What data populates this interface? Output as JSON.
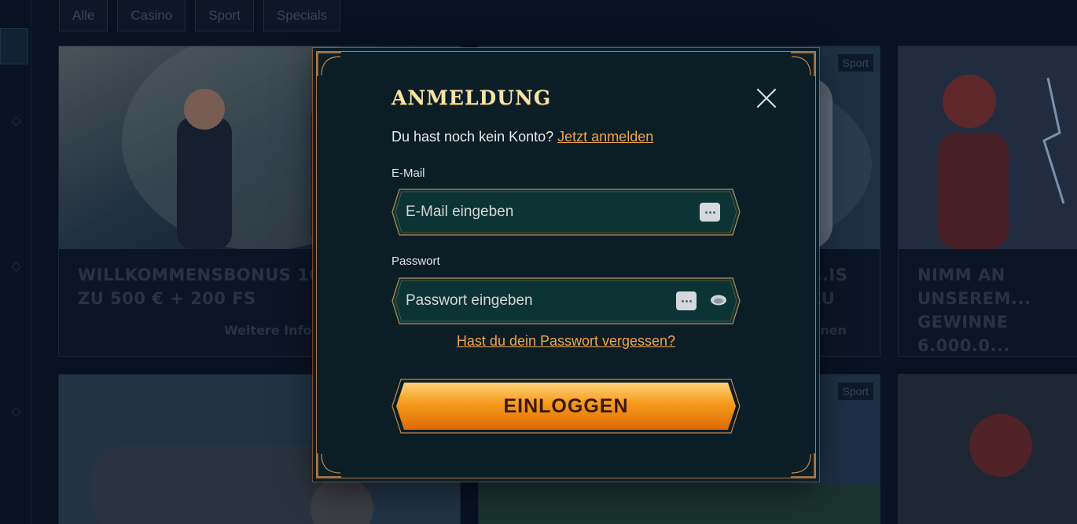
{
  "background": {
    "filters": [
      "Alle",
      "Casino",
      "Sport",
      "Specials"
    ],
    "promos": [
      {
        "title": "Willkommensbonus 100 % bis zu 500 € + 200 FS",
        "more": "Weitere Infos"
      },
      {
        "title": "...is zu",
        "more": "...nen",
        "tag": "Sport"
      },
      {
        "title": "Nimm an unserem... Gewinne 6.000.0..."
      }
    ],
    "bottom_tag": "Sport"
  },
  "modal": {
    "title": "ANMELDUNG",
    "signup_prompt": "Du hast noch kein Konto?",
    "signup_link": "Jetzt anmelden",
    "email": {
      "label": "E-Mail",
      "placeholder": "E-Mail eingeben",
      "value": ""
    },
    "password": {
      "label": "Passwort",
      "placeholder": "Passwort eingeben",
      "value": ""
    },
    "forgot_link": "Hast du dein Passwort vergessen?",
    "login_button": "EINLOGGEN"
  },
  "colors": {
    "accent_link": "#f2a54a",
    "button_orange": "#f08a10",
    "modal_bg": "#0b1e26",
    "field_bg": "#0c3434",
    "frame_gold": "#b07a4a"
  },
  "icons": [
    "close-icon",
    "autofill-key-icon",
    "eye-icon",
    "corner-ornament-icon"
  ]
}
